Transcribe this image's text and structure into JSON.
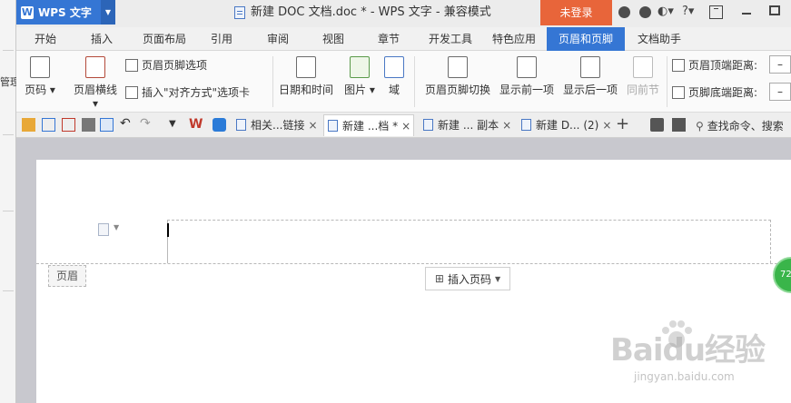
{
  "background_window": {
    "label": "管理"
  },
  "titlebar": {
    "app_name": "WPS 文字",
    "doc_title": "新建 DOC 文档.doc * - WPS 文字 - 兼容模式",
    "login_label": "未登录",
    "help_label": "?"
  },
  "menu": {
    "tabs": [
      "开始",
      "插入",
      "页面布局",
      "引用",
      "审阅",
      "视图",
      "章节",
      "开发工具",
      "特色应用",
      "页眉和页脚",
      "文档助手"
    ],
    "active_tab": "页眉和页脚"
  },
  "ribbon": {
    "page_number": "页码",
    "header_horizontal_line": "页眉横线",
    "header_footer_options": "页眉页脚选项",
    "insert_align_tab": "插入\"对齐方式\"选项卡",
    "date_time": "日期和时间",
    "picture": "图片",
    "field": "域",
    "switch_header_footer": "页眉页脚切换",
    "show_previous": "显示前一项",
    "show_next": "显示后一项",
    "same_as_previous": "同前节",
    "header_top_distance": "页眉顶端距离:",
    "footer_bottom_distance": "页脚底端距离:",
    "spinner_symbol": "–"
  },
  "quickbar": {
    "search_label": "查找命令、搜索",
    "doc_tabs": [
      {
        "label": "相关...链接",
        "active": false
      },
      {
        "label": "新建 ...档 *",
        "active": true
      },
      {
        "label": "新建 ... 副本",
        "active": false
      },
      {
        "label": "新建 D... (2)",
        "active": false
      }
    ],
    "close_symbol": "×",
    "new_tab_symbol": "+"
  },
  "document": {
    "header_label": "页眉",
    "insert_page_number": "插入页码",
    "badge_text": "72"
  },
  "watermark": {
    "brand": "Baidu经验",
    "url": "jingyan.baidu.com"
  },
  "colors": {
    "accent": "#3576d4",
    "login": "#e8653a",
    "badge": "#3ab54a"
  }
}
